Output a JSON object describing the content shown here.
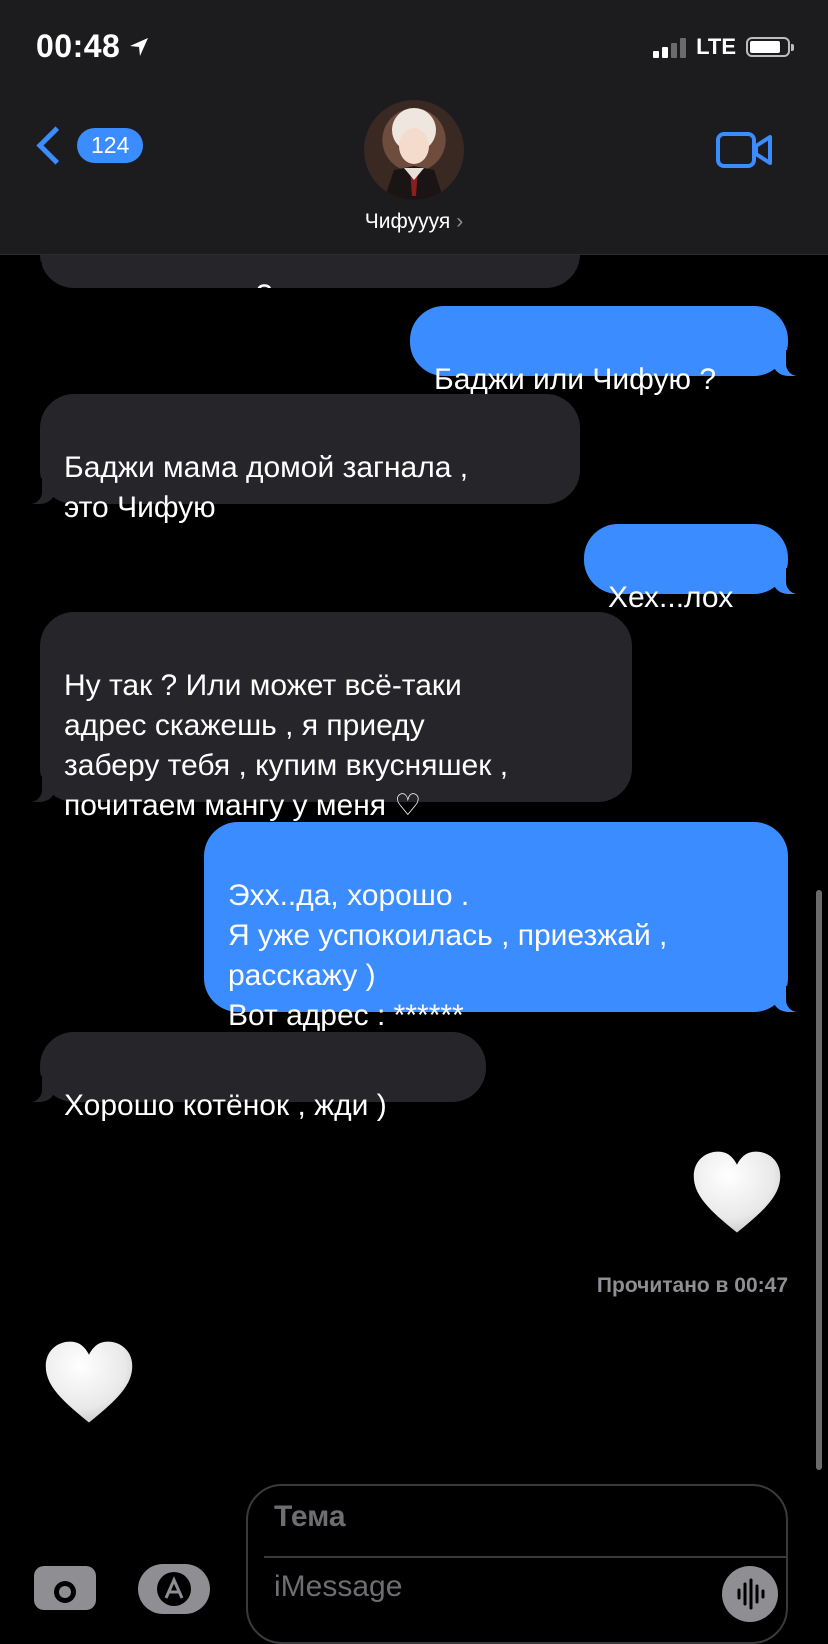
{
  "status": {
    "time": "00:48",
    "network": "LTE"
  },
  "header": {
    "back_count": "124",
    "contact_name": "Чифуууя"
  },
  "messages": [
    {
      "dir": "in",
      "text": "случилось то ?"
    },
    {
      "dir": "out",
      "text": "Баджи или Чифую ?"
    },
    {
      "dir": "in",
      "text": "Баджи мама домой загнала ,\nэто Чифую"
    },
    {
      "dir": "out",
      "text": "Хех...лох"
    },
    {
      "dir": "in",
      "text": "Ну так ? Или может всё-таки\nадрес скажешь , я приеду\nзаберу тебя , купим вкусняшек ,\nпочитаем мангу у меня ♡"
    },
    {
      "dir": "out",
      "text": "Эхх..да, хорошо .\nЯ уже успокоилась , приезжай ,\nрасскажу )\nВот адрес : ******"
    },
    {
      "dir": "in",
      "text": "Хорошо котёнок , жди )"
    }
  ],
  "read_receipt": "Прочитано в 00:47",
  "input": {
    "subject_placeholder": "Тема",
    "message_placeholder": "iMessage"
  },
  "colors": {
    "accent": "#3b8cff",
    "incoming": "#26252a",
    "background": "#000000"
  }
}
